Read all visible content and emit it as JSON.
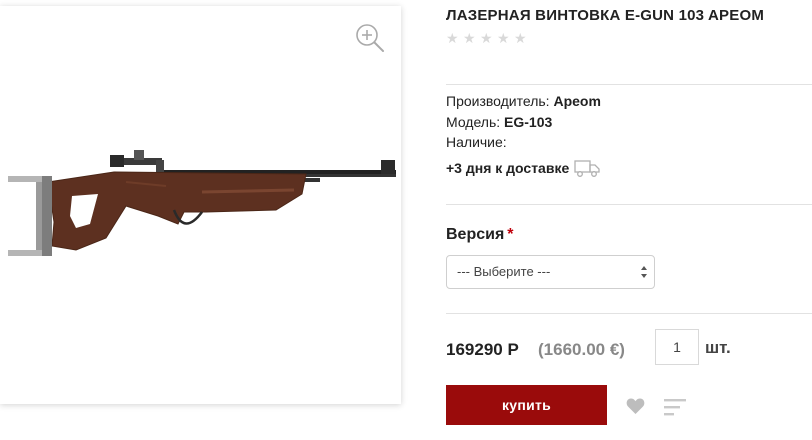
{
  "product": {
    "title": "ЛАЗЕРНАЯ ВИНТОВКА E-GUN 103 APEOM",
    "rating": 0,
    "rating_max": 5,
    "manufacturer_label": "Производитель:",
    "manufacturer_value": "Apeom",
    "model_label": "Модель:",
    "model_value": "EG-103",
    "availability_label": "Наличие:",
    "delivery_text": "+3 дня к доставке",
    "image_icon": "rifle-image",
    "zoom_icon": "zoom-in-icon"
  },
  "options": {
    "version_label": "Версия",
    "required_mark": "*",
    "select_value": "--- Выберите ---"
  },
  "pricing": {
    "price": "169290 Р",
    "price_eur": "(1660.00 €)",
    "quantity": "1",
    "unit": "шт."
  },
  "actions": {
    "buy_label": "купить",
    "wishlist_icon": "heart-icon",
    "compare_icon": "compare-icon"
  },
  "colors": {
    "buy_button": "#9a0b0b",
    "required": "#c0000b",
    "star_empty": "#d9d9d9"
  }
}
